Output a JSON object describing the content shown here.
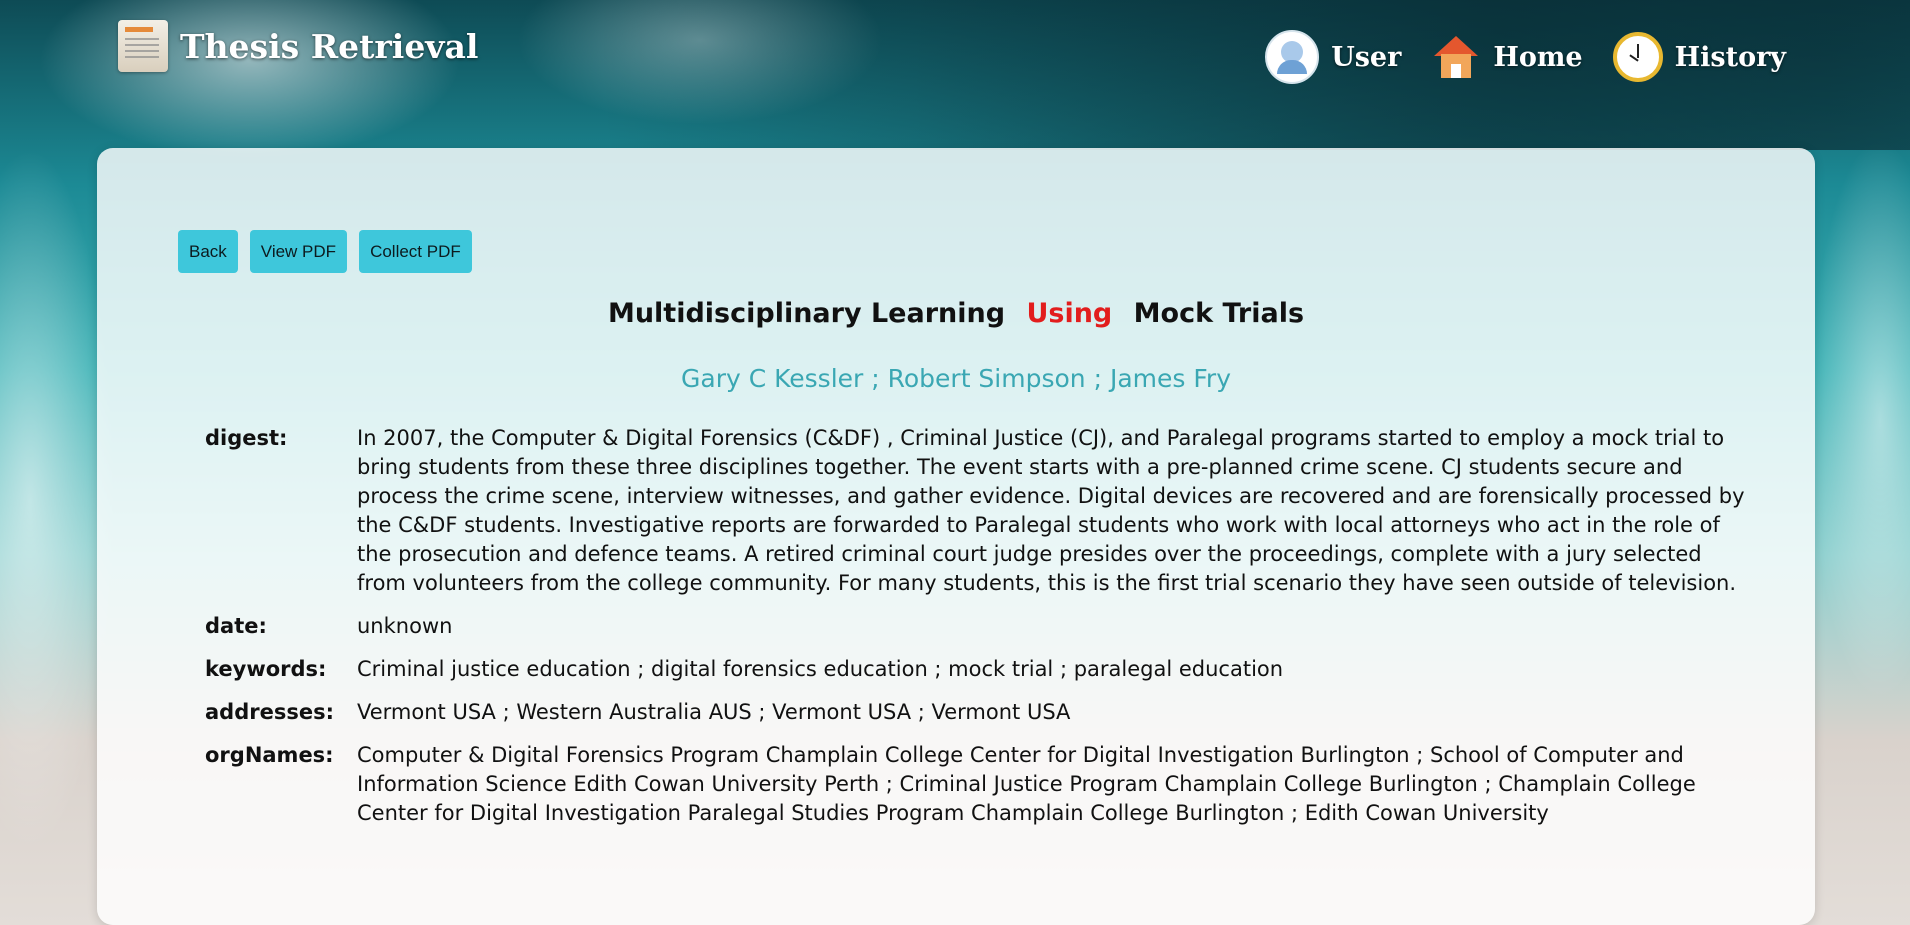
{
  "header": {
    "brand_title": "Thesis Retrieval",
    "nav": [
      {
        "label": "User",
        "icon": "user-avatar-icon"
      },
      {
        "label": "Home",
        "icon": "home-icon"
      },
      {
        "label": "History",
        "icon": "clock-icon"
      }
    ]
  },
  "actions": {
    "back": "Back",
    "view_pdf": "View PDF",
    "collect_pdf": "Collect PDF"
  },
  "paper": {
    "title_part1": "Multidisciplinary Learning",
    "title_highlight": "Using",
    "title_part2": "Mock Trials",
    "authors": "Gary C Kessler ; Robert Simpson ; James Fry",
    "fields": [
      {
        "label": "digest:",
        "value": "In 2007, the Computer & Digital Forensics (C&DF) , Criminal Justice (CJ), and Paralegal programs started to employ a mock trial to bring students from these three disciplines together. The event starts with a pre-planned crime scene. CJ students secure and process the crime scene, interview witnesses, and gather evidence. Digital devices are recovered and are forensically processed by the C&DF students. Investigative reports are forwarded to Paralegal students who work with local attorneys who act in the role of the prosecution and defence teams. A retired criminal court judge presides over the proceedings, complete with a jury selected from volunteers from the college community. For many students, this is the first trial scenario they have seen outside of television."
      },
      {
        "label": "date:",
        "value": "unknown"
      },
      {
        "label": "keywords:",
        "value": "Criminal justice education ; digital forensics education ; mock trial ; paralegal education"
      },
      {
        "label": "addresses:",
        "value": "Vermont USA ; Western Australia AUS ; Vermont USA ; Vermont USA"
      },
      {
        "label": "orgNames:",
        "value": "Computer & Digital Forensics Program Champlain College Center for Digital Investigation Burlington ; School of Computer and Information Science Edith Cowan University Perth ; Criminal Justice Program Champlain College Burlington ; Champlain College Center for Digital Investigation Paralegal Studies Program Champlain College Burlington ; Edith Cowan University"
      }
    ]
  },
  "colors": {
    "button_bg": "#3ec7db",
    "title_highlight": "#e21d1d",
    "authors": "#3aa7b3"
  }
}
